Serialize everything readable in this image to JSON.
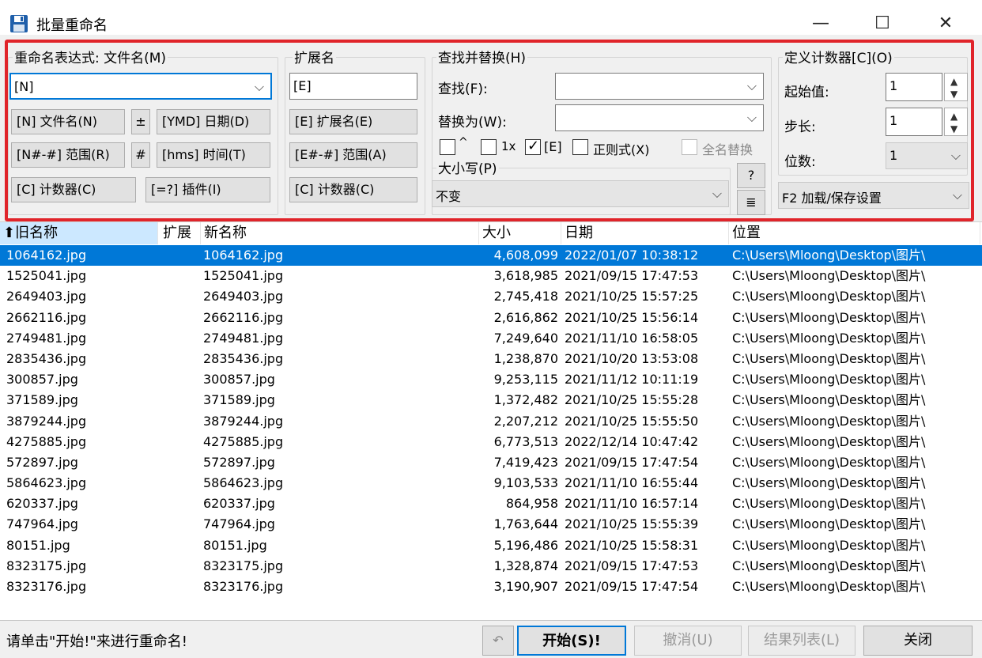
{
  "window": {
    "title": "批量重命名",
    "minimize": "—",
    "maximize": "☐",
    "close": "✕"
  },
  "mask_group": {
    "label": "重命名表达式: 文件名(M)",
    "value": "[N]",
    "buttons": [
      "[N] 文件名(N)",
      "±",
      "[YMD] 日期(D)",
      "[N#-#] 范围(R)",
      "#",
      "[hms] 时间(T)",
      "[C] 计数器(C)",
      "[=?] 插件(I)"
    ]
  },
  "ext_group": {
    "label": "扩展名",
    "value": "[E]",
    "buttons": [
      "[E] 扩展名(E)",
      "[E#-#] 范围(A)",
      "[C] 计数器(C)"
    ]
  },
  "search_group": {
    "label": "查找并替换(H)",
    "find_label": "查找(F):",
    "find_value": "",
    "replace_label": "替换为(W):",
    "replace_value": "",
    "opt_caret": "^",
    "opt_once": "1x",
    "opt_ext": "[E]",
    "opt_regex": "正则式(X)",
    "opt_whole": "全名替换",
    "case_label": "大小写(P)",
    "case_value": "不变",
    "help_btn": "?",
    "edit_btn": "≣"
  },
  "counter_group": {
    "label": "定义计数器[C](O)",
    "start_label": "起始值:",
    "start_value": "1",
    "step_label": "步长:",
    "step_value": "1",
    "digits_label": "位数:",
    "digits_value": "1",
    "settings_value": "F2 加载/保存设置"
  },
  "list": {
    "headers": [
      "旧名称",
      "扩展",
      "新名称",
      "大小",
      "日期",
      "位置"
    ],
    "sort_arrow": "⬆",
    "rows": [
      {
        "old": "1064162.jpg",
        "new": "1064162.jpg",
        "size": "4,608,099",
        "date": "2022/01/07 10:38:12",
        "loc": "C:\\Users\\Mloong\\Desktop\\图片\\"
      },
      {
        "old": "1525041.jpg",
        "new": "1525041.jpg",
        "size": "3,618,985",
        "date": "2021/09/15 17:47:53",
        "loc": "C:\\Users\\Mloong\\Desktop\\图片\\"
      },
      {
        "old": "2649403.jpg",
        "new": "2649403.jpg",
        "size": "2,745,418",
        "date": "2021/10/25 15:57:25",
        "loc": "C:\\Users\\Mloong\\Desktop\\图片\\"
      },
      {
        "old": "2662116.jpg",
        "new": "2662116.jpg",
        "size": "2,616,862",
        "date": "2021/10/25 15:56:14",
        "loc": "C:\\Users\\Mloong\\Desktop\\图片\\"
      },
      {
        "old": "2749481.jpg",
        "new": "2749481.jpg",
        "size": "7,249,640",
        "date": "2021/11/10 16:58:05",
        "loc": "C:\\Users\\Mloong\\Desktop\\图片\\"
      },
      {
        "old": "2835436.jpg",
        "new": "2835436.jpg",
        "size": "1,238,870",
        "date": "2021/10/20 13:53:08",
        "loc": "C:\\Users\\Mloong\\Desktop\\图片\\"
      },
      {
        "old": "300857.jpg",
        "new": "300857.jpg",
        "size": "9,253,115",
        "date": "2021/11/12 10:11:19",
        "loc": "C:\\Users\\Mloong\\Desktop\\图片\\"
      },
      {
        "old": "371589.jpg",
        "new": "371589.jpg",
        "size": "1,372,482",
        "date": "2021/10/25 15:55:28",
        "loc": "C:\\Users\\Mloong\\Desktop\\图片\\"
      },
      {
        "old": "3879244.jpg",
        "new": "3879244.jpg",
        "size": "2,207,212",
        "date": "2021/10/25 15:55:50",
        "loc": "C:\\Users\\Mloong\\Desktop\\图片\\"
      },
      {
        "old": "4275885.jpg",
        "new": "4275885.jpg",
        "size": "6,773,513",
        "date": "2022/12/14 10:47:42",
        "loc": "C:\\Users\\Mloong\\Desktop\\图片\\"
      },
      {
        "old": "572897.jpg",
        "new": "572897.jpg",
        "size": "7,419,423",
        "date": "2021/09/15 17:47:54",
        "loc": "C:\\Users\\Mloong\\Desktop\\图片\\"
      },
      {
        "old": "5864623.jpg",
        "new": "5864623.jpg",
        "size": "9,103,533",
        "date": "2021/11/10 16:55:44",
        "loc": "C:\\Users\\Mloong\\Desktop\\图片\\"
      },
      {
        "old": "620337.jpg",
        "new": "620337.jpg",
        "size": "864,958",
        "date": "2021/11/10 16:57:14",
        "loc": "C:\\Users\\Mloong\\Desktop\\图片\\"
      },
      {
        "old": "747964.jpg",
        "new": "747964.jpg",
        "size": "1,763,644",
        "date": "2021/10/25 15:55:39",
        "loc": "C:\\Users\\Mloong\\Desktop\\图片\\"
      },
      {
        "old": "80151.jpg",
        "new": "80151.jpg",
        "size": "5,196,486",
        "date": "2021/10/25 15:58:31",
        "loc": "C:\\Users\\Mloong\\Desktop\\图片\\"
      },
      {
        "old": "8323175.jpg",
        "new": "8323175.jpg",
        "size": "1,328,874",
        "date": "2021/09/15 17:47:53",
        "loc": "C:\\Users\\Mloong\\Desktop\\图片\\"
      },
      {
        "old": "8323176.jpg",
        "new": "8323176.jpg",
        "size": "3,190,907",
        "date": "2021/09/15 17:47:54",
        "loc": "C:\\Users\\Mloong\\Desktop\\图片\\"
      }
    ]
  },
  "status": {
    "text": "请单击\"开始!\"来进行重命名!",
    "undo_icon": "↶",
    "start": "开始(S)!",
    "undo": "撤消(U)",
    "result_list": "结果列表(L)",
    "close": "关闭"
  }
}
